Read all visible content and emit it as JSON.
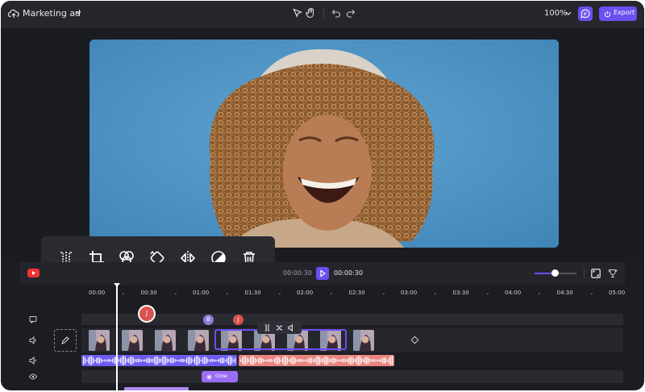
{
  "project": {
    "title": "Marketing ad"
  },
  "toolbar": {
    "zoom": "100%",
    "export_label": "Export"
  },
  "player": {
    "current_time": "00:00:30",
    "total_time": "00:00:30"
  },
  "ruler": {
    "ticks": [
      "00:00",
      "00:30",
      "01:00",
      "01:30",
      "02:00",
      "02:30",
      "03:00",
      "03:30",
      "04:00",
      "04:30",
      "05:00"
    ]
  },
  "collaborators": {
    "big": "J",
    "b": "B",
    "j": "J"
  },
  "effects": {
    "glow_label": "Glow"
  },
  "colors": {
    "accent": "#6b4ff0",
    "audio_a": "#6c5cf0",
    "audio_b": "#e8847f",
    "glow": "#9b6df5",
    "avatar_red": "#d9534f",
    "avatar_purple": "#8f7ad8"
  },
  "icons": [
    "cloud-upload-icon",
    "chevron-down-icon",
    "pointer-icon",
    "hand-icon",
    "undo-icon",
    "redo-icon",
    "comment-icon",
    "power-icon",
    "split-icon",
    "crop-icon",
    "color-icon",
    "rotate-icon",
    "flip-icon",
    "filter-icon",
    "trash-icon",
    "youtube-icon",
    "play-icon",
    "fullscreen-icon",
    "trophy-icon",
    "edit-icon",
    "caption-icon",
    "speaker-icon",
    "eye-icon"
  ]
}
